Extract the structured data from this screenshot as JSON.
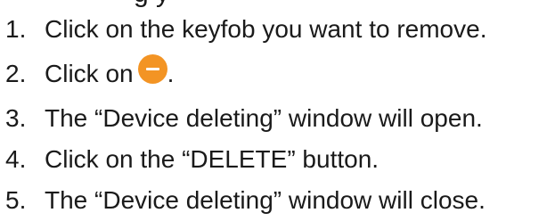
{
  "partial_heading": "g   y",
  "steps": [
    {
      "number": "1.",
      "text": "Click on the keyfob you want to remove."
    },
    {
      "number": "2.",
      "text": "Click on",
      "icon": "minus-circle-icon",
      "icon_color": "#f39424",
      "tail": "."
    },
    {
      "number": "3.",
      "text": "The “Device deleting” window will open."
    },
    {
      "number": "4.",
      "text": "Click on the “DELETE” button."
    },
    {
      "number": "5.",
      "text": "The “Device deleting” window will close."
    }
  ]
}
